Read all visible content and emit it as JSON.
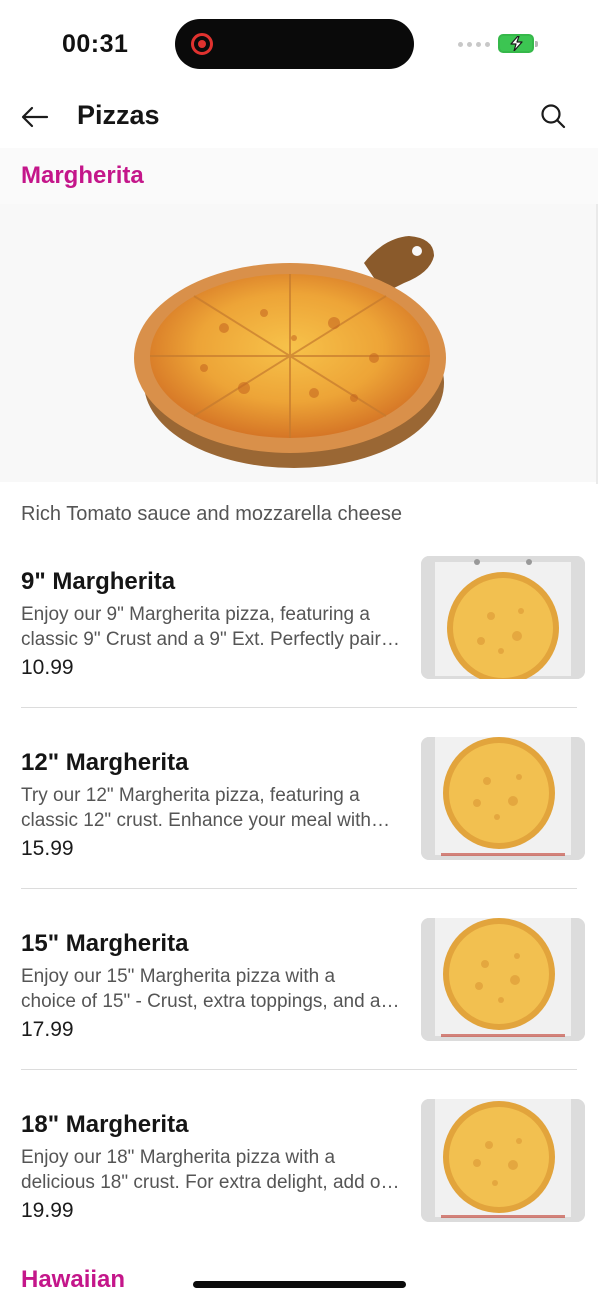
{
  "status_bar": {
    "time": "00:31",
    "recording_icon": "screen-recording-icon",
    "signal_icon": "cellular-signal-icon",
    "battery_icon": "battery-charging-icon",
    "accent_recording": "#e0322f",
    "accent_battery": "#3cc552"
  },
  "header": {
    "title": "Pizzas",
    "back_icon": "arrow-left-icon",
    "search_icon": "search-icon"
  },
  "section": {
    "title": "Margherita",
    "description": "Rich Tomato sauce and mozzarella cheese",
    "title_color": "#c4168a"
  },
  "items": [
    {
      "name": "9\" Margherita",
      "desc_line1": "Enjoy our 9\" Margherita pizza, featuring a",
      "desc_line2": "classic 9\" Crust and a 9\" Ext. Perfectly pair…",
      "price": "10.99"
    },
    {
      "name": "12\" Margherita",
      "desc_line1": "Try our 12\" Margherita pizza, featuring a",
      "desc_line2": "classic 12\" crust. Enhance your meal with…",
      "price": "15.99"
    },
    {
      "name": "15\" Margherita",
      "desc_line1": "Enjoy our 15\" Margherita pizza with a",
      "desc_line2": "choice of 15\" - Crust, extra toppings, and a…",
      "price": "17.99"
    },
    {
      "name": "18\" Margherita",
      "desc_line1": "Enjoy our 18\" Margherita pizza with a",
      "desc_line2": "delicious 18\" crust. For extra delight, add o…",
      "price": "19.99"
    }
  ],
  "next_section": {
    "title": "Hawaiian"
  }
}
